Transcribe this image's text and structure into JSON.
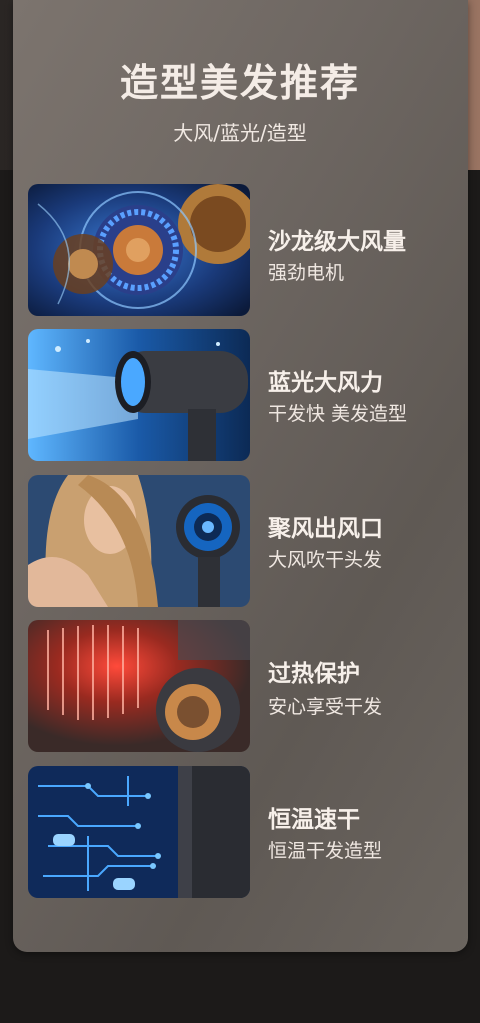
{
  "header": {
    "title": "造型美发推荐",
    "subtitle": "大风/蓝光/造型"
  },
  "features": [
    {
      "title": "沙龙级大风量",
      "subtitle": "强劲电机",
      "image": "motor-image"
    },
    {
      "title": "蓝光大风力",
      "subtitle": "干发快 美发造型",
      "image": "blue-light-dryer-image"
    },
    {
      "title": "聚风出风口",
      "subtitle": "大风吹干头发",
      "image": "model-hair-image"
    },
    {
      "title": "过热保护",
      "subtitle": "安心享受干发",
      "image": "heating-element-image"
    },
    {
      "title": "恒温速干",
      "subtitle": "恒温干发造型",
      "image": "circuit-board-image"
    }
  ],
  "colors": {
    "panel": "#6e6762",
    "text": "#f4ece6",
    "page_bg": "#1c1a19"
  }
}
